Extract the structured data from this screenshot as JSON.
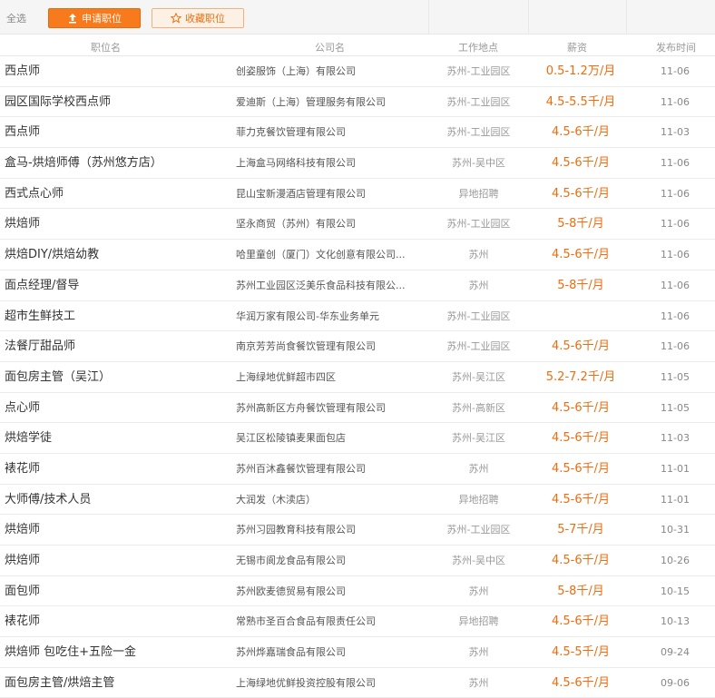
{
  "toolbar": {
    "select_all": "全选",
    "apply_label": "申请职位",
    "favorite_label": "收藏职位"
  },
  "header": {
    "name": "职位名",
    "company": "公司名",
    "location": "工作地点",
    "salary": "薪资",
    "date": "发布时间"
  },
  "colors": {
    "accent": "#f77b1c",
    "salary": "#f06c0e"
  },
  "rows": [
    {
      "name": "西点师",
      "company": "创姿服饰（上海）有限公司",
      "location": "苏州-工业园区",
      "salary": "0.5-1.2万/月",
      "date": "11-06"
    },
    {
      "name": "园区国际学校西点师",
      "company": "爱迪斯（上海）管理服务有限公司",
      "location": "苏州-工业园区",
      "salary": "4.5-5.5千/月",
      "date": "11-06"
    },
    {
      "name": "西点师",
      "company": "菲力克餐饮管理有限公司",
      "location": "苏州-工业园区",
      "salary": "4.5-6千/月",
      "date": "11-03"
    },
    {
      "name": "盒马-烘焙师傅（苏州悠方店）",
      "company": "上海盒马网络科技有限公司",
      "location": "苏州-吴中区",
      "salary": "4.5-6千/月",
      "date": "11-06"
    },
    {
      "name": "西式点心师",
      "company": "昆山宝新漫酒店管理有限公司",
      "location": "异地招聘",
      "salary": "4.5-6千/月",
      "date": "11-06"
    },
    {
      "name": "烘焙师",
      "company": "坚永商贸（苏州）有限公司",
      "location": "苏州-工业园区",
      "salary": "5-8千/月",
      "date": "11-06"
    },
    {
      "name": "烘焙DIY/烘焙幼教",
      "company": "哈里童创（厦门）文化创意有限公司...",
      "location": "苏州",
      "salary": "4.5-6千/月",
      "date": "11-06"
    },
    {
      "name": "面点经理/督导",
      "company": "苏州工业园区泛美乐食品科技有限公...",
      "location": "苏州",
      "salary": "5-8千/月",
      "date": "11-06"
    },
    {
      "name": "超市生鲜技工",
      "company": "华润万家有限公司-华东业务单元",
      "location": "苏州-工业园区",
      "salary": "",
      "date": "11-06"
    },
    {
      "name": "法餐厅甜品师",
      "company": "南京芳芳尚食餐饮管理有限公司",
      "location": "苏州-工业园区",
      "salary": "4.5-6千/月",
      "date": "11-06"
    },
    {
      "name": "面包房主管（吴江）",
      "company": "上海绿地优鲜超市四区",
      "location": "苏州-吴江区",
      "salary": "5.2-7.2千/月",
      "date": "11-05"
    },
    {
      "name": "点心师",
      "company": "苏州高新区方舟餐饮管理有限公司",
      "location": "苏州-高新区",
      "salary": "4.5-6千/月",
      "date": "11-05"
    },
    {
      "name": "烘焙学徒",
      "company": "吴江区松陵镇麦果面包店",
      "location": "苏州-吴江区",
      "salary": "4.5-6千/月",
      "date": "11-03"
    },
    {
      "name": "裱花师",
      "company": "苏州百沐鑫餐饮管理有限公司",
      "location": "苏州",
      "salary": "4.5-6千/月",
      "date": "11-01"
    },
    {
      "name": "大师傅/技术人员",
      "company": "大润发（木渎店）",
      "location": "异地招聘",
      "salary": "4.5-6千/月",
      "date": "11-01"
    },
    {
      "name": "烘焙师",
      "company": "苏州习园教育科技有限公司",
      "location": "苏州-工业园区",
      "salary": "5-7千/月",
      "date": "10-31"
    },
    {
      "name": "烘焙师",
      "company": "无锡市阆龙食品有限公司",
      "location": "苏州-吴中区",
      "salary": "4.5-6千/月",
      "date": "10-26"
    },
    {
      "name": "面包师",
      "company": "苏州欧麦德贸易有限公司",
      "location": "苏州",
      "salary": "5-8千/月",
      "date": "10-15"
    },
    {
      "name": "裱花师",
      "company": "常熟市圣百合食品有限责任公司",
      "location": "异地招聘",
      "salary": "4.5-6千/月",
      "date": "10-13"
    },
    {
      "name": "烘焙师 包吃住+五险一金",
      "company": "苏州烨嘉瑞食品有限公司",
      "location": "苏州",
      "salary": "4.5-5千/月",
      "date": "09-24"
    },
    {
      "name": "面包房主管/烘焙主管",
      "company": "上海绿地优鲜投资控股有限公司",
      "location": "苏州",
      "salary": "4.5-6千/月",
      "date": "09-06"
    }
  ]
}
